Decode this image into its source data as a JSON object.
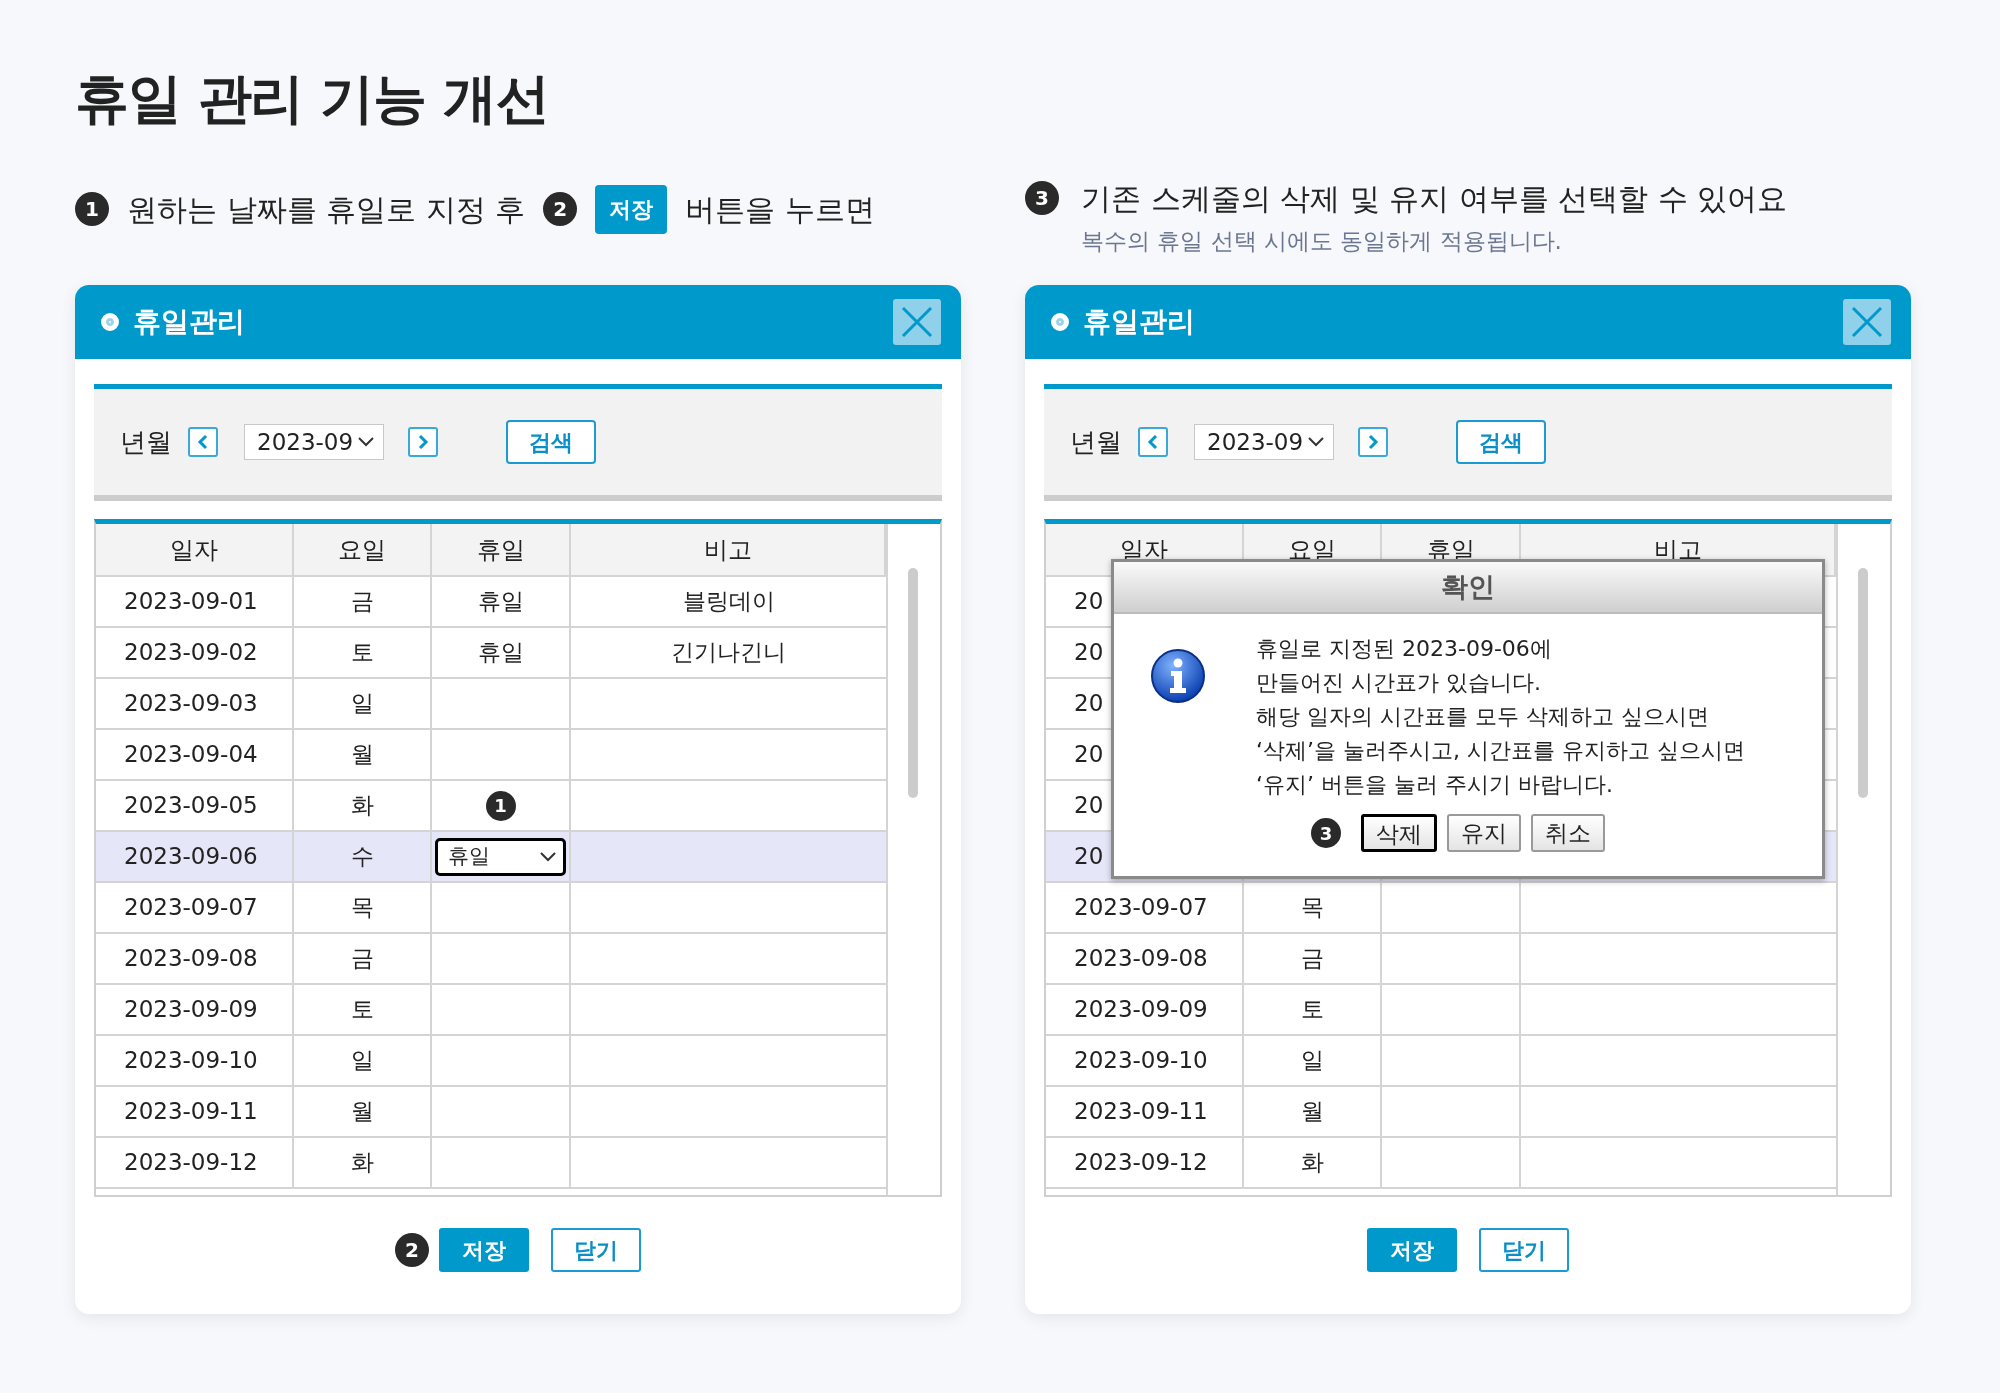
{
  "title": "휴일 관리 기능 개선",
  "left_caption": [
    {
      "kind": "badge",
      "text": "1"
    },
    {
      "kind": "text",
      "text": "원하는 날짜를 휴일로 지정 후"
    },
    {
      "kind": "badge",
      "text": "2"
    },
    {
      "kind": "button",
      "text": "저장"
    },
    {
      "kind": "text",
      "text": "버튼을 누르면"
    }
  ],
  "right_caption": {
    "badge": "3",
    "text": "기존 스케줄의 삭제 및 유지 여부를 선택할 수 있어요",
    "subtext": "복수의 휴일 선택 시에도 동일하게 적용됩니다."
  },
  "panels": [
    {
      "title": "휴일관리",
      "month_label": "년월",
      "month": "2023-09",
      "search": "검색",
      "columns": [
        "일자",
        "요일",
        "휴일",
        "비고"
      ],
      "rows": [
        {
          "date": "2023-09-01",
          "weekday": "금",
          "holiday": {
            "kind": "text",
            "text": "휴일"
          },
          "note": "블링데이",
          "selected": false
        },
        {
          "date": "2023-09-02",
          "weekday": "토",
          "holiday": {
            "kind": "text",
            "text": "휴일"
          },
          "note": "긴기나긴니",
          "selected": false
        },
        {
          "date": "2023-09-03",
          "weekday": "일",
          "selected": false
        },
        {
          "date": "2023-09-04",
          "weekday": "월",
          "selected": false
        },
        {
          "date": "2023-09-05",
          "weekday": "화",
          "holiday": {
            "kind": "badge",
            "text": "1"
          },
          "selected": false
        },
        {
          "date": "2023-09-06",
          "weekday": "수",
          "holiday": {
            "kind": "select",
            "text": "휴일"
          },
          "selected": true
        },
        {
          "date": "2023-09-07",
          "weekday": "목",
          "selected": false
        },
        {
          "date": "2023-09-08",
          "weekday": "금",
          "selected": false
        },
        {
          "date": "2023-09-09",
          "weekday": "토",
          "selected": false
        },
        {
          "date": "2023-09-10",
          "weekday": "일",
          "selected": false
        },
        {
          "date": "2023-09-11",
          "weekday": "월",
          "selected": false
        },
        {
          "date": "2023-09-12",
          "weekday": "화",
          "selected": false
        }
      ],
      "footer_badge": "2",
      "buttons": [
        {
          "label": "저장",
          "primary": true
        },
        {
          "label": "닫기",
          "primary": false
        }
      ]
    },
    {
      "title": "휴일관리",
      "month_label": "년월",
      "month": "2023-09",
      "search": "검색",
      "columns": [
        "일자",
        "요일",
        "휴일",
        "비고"
      ],
      "rows": [
        {
          "date": "20",
          "selected": false
        },
        {
          "date": "20",
          "selected": false
        },
        {
          "date": "20",
          "selected": false
        },
        {
          "date": "20",
          "selected": false
        },
        {
          "date": "20",
          "selected": false
        },
        {
          "date": "20",
          "selected": true
        },
        {
          "date": "2023-09-07",
          "weekday": "목",
          "selected": false
        },
        {
          "date": "2023-09-08",
          "weekday": "금",
          "selected": false
        },
        {
          "date": "2023-09-09",
          "weekday": "토",
          "selected": false
        },
        {
          "date": "2023-09-10",
          "weekday": "일",
          "selected": false
        },
        {
          "date": "2023-09-11",
          "weekday": "월",
          "selected": false
        },
        {
          "date": "2023-09-12",
          "weekday": "화",
          "selected": false
        }
      ],
      "buttons": [
        {
          "label": "저장",
          "primary": true
        },
        {
          "label": "닫기",
          "primary": false
        }
      ],
      "dialog": {
        "title": "확인",
        "message": "휴일로 지정된 2023-09-06에\n만들어진 시간표가 있습니다.\n해당 일자의 시간표를 모두 삭제하고 싶으시면\n‘삭제’을 눌러주시고, 시간표를 유지하고 싶으시면\n‘유지’ 버튼을 눌러 주시기 바랍니다.",
        "badge": "3",
        "buttons": [
          {
            "label": "삭제",
            "focused": true
          },
          {
            "label": "유지",
            "focused": false
          },
          {
            "label": "취소",
            "focused": false
          }
        ]
      }
    }
  ]
}
